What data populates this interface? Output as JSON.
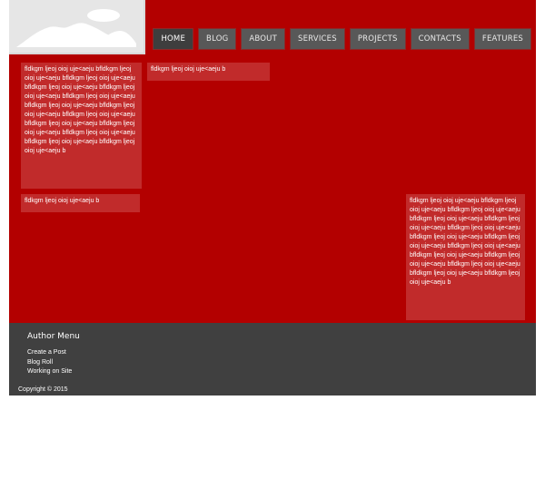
{
  "nav": {
    "items": [
      {
        "label": "HOME",
        "active": true
      },
      {
        "label": "BLOG"
      },
      {
        "label": "ABOUT"
      },
      {
        "label": "SERVICES"
      },
      {
        "label": "PROJECTS"
      },
      {
        "label": "CONTACTS"
      },
      {
        "label": "FEATURES"
      }
    ]
  },
  "content": {
    "block_long_left": "fldkgm ljeoj oioj uje<aeju bfldkgm ljeoj oioj uje<aeju bfldkgm ljeoj oioj uje<aeju bfldkgm ljeoj oioj uje<aeju bfldkgm ljeoj oioj uje<aeju bfldkgm ljeoj oioj uje<aeju bfldkgm ljeoj oioj uje<aeju bfldkgm ljeoj oioj uje<aeju bfldkgm ljeoj oioj uje<aeju bfldkgm ljeoj oioj uje<aeju bfldkgm ljeoj oioj uje<aeju bfldkgm ljeoj oioj uje<aeju bfldkgm ljeoj oioj uje<aeju bfldkgm ljeoj oioj uje<aeju b",
    "block_short_top": "fldkgm ljeoj oioj uje<aeju b",
    "block_short_left": "fldkgm ljeoj oioj uje<aeju b",
    "block_long_right": "fldkgm ljeoj oioj uje<aeju bfldkgm ljeoj oioj uje<aeju bfldkgm ljeoj oioj uje<aeju bfldkgm ljeoj oioj uje<aeju bfldkgm ljeoj oioj uje<aeju bfldkgm ljeoj oioj uje<aeju bfldkgm ljeoj oioj uje<aeju bfldkgm ljeoj oioj uje<aeju bfldkgm ljeoj oioj uje<aeju bfldkgm ljeoj oioj uje<aeju bfldkgm ljeoj oioj uje<aeju bfldkgm ljeoj oioj uje<aeju bfldkgm ljeoj oioj uje<aeju bfldkgm ljeoj oioj uje<aeju b"
  },
  "footer": {
    "menu_title": "Author Menu",
    "links": [
      "Create a Post",
      "Blog Roll",
      "Working on Site"
    ],
    "copyright": "Copyright © 2015"
  },
  "colors": {
    "page_bg": "#b30000",
    "content_box": "#c12b2b",
    "nav_button": "#585858",
    "nav_active": "#3e3e3e",
    "footer_bg": "#404040"
  },
  "icons": {
    "logo": "image-placeholder-icon"
  }
}
